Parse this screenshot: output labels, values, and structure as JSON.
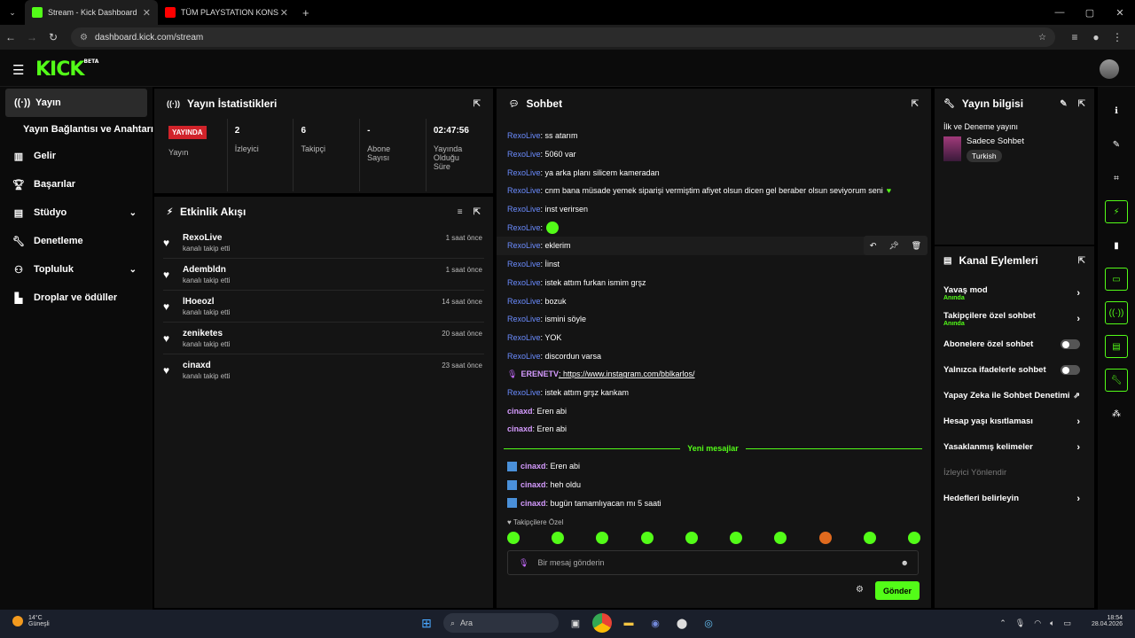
{
  "browser": {
    "tabs": [
      {
        "label": "Stream - Kick Dashboard",
        "active": true
      },
      {
        "label": "TÜM PLAYSTATION KONSOLLAR",
        "active": false
      }
    ],
    "new_tab": "+",
    "url": "dashboard.kick.com/stream"
  },
  "brand": {
    "logo": "KICK",
    "beta": "BETA",
    "accent": "#53fc18"
  },
  "sidebar": {
    "items": [
      {
        "label": "Yayın",
        "icon": "broadcast-icon"
      },
      {
        "label": "Yayın Bağlantısı ve Anahtarı",
        "sub": true
      },
      {
        "label": "Gelir",
        "icon": "revenue-icon"
      },
      {
        "label": "Başarılar",
        "icon": "trophy-icon"
      },
      {
        "label": "Stüdyo",
        "icon": "studio-icon",
        "chevron": true
      },
      {
        "label": "Denetleme",
        "icon": "wrench-icon"
      },
      {
        "label": "Topluluk",
        "icon": "community-icon",
        "chevron": true
      },
      {
        "label": "Droplar ve ödüller",
        "icon": "drops-icon"
      }
    ]
  },
  "stats": {
    "title": "Yayın İstatistikleri",
    "live_badge": "YAYINDA",
    "items": [
      {
        "value": "2",
        "label": "İzleyici"
      },
      {
        "value": "6",
        "label": "Takipçi"
      },
      {
        "value": "-",
        "label": "Abone Sayısı"
      },
      {
        "value": "02:47:56",
        "label": "Yayında Olduğu Süre"
      }
    ],
    "live_label": "Yayın"
  },
  "activity": {
    "title": "Etkinlik Akışı",
    "events": [
      {
        "name": "RexoLive",
        "action": "kanalı takip etti",
        "time": "1 saat önce"
      },
      {
        "name": "Adembldn",
        "action": "kanalı takip etti",
        "time": "1 saat önce"
      },
      {
        "name": "lHoeozl",
        "action": "kanalı takip etti",
        "time": "14 saat önce"
      },
      {
        "name": "zeniketes",
        "action": "kanalı takip etti",
        "time": "20 saat önce"
      },
      {
        "name": "cinaxd",
        "action": "kanalı takip etti",
        "time": "23 saat önce"
      }
    ]
  },
  "chat": {
    "title": "Sohbet",
    "messages": [
      {
        "user": "RexoLive",
        "text": ": ss atarım"
      },
      {
        "user": "RexoLive",
        "text": ": 5060 var"
      },
      {
        "user": "RexoLive",
        "text": ": ya arka planı silicem kameradan"
      },
      {
        "user": "RexoLive",
        "text": ": cnm bana müsade yemek siparişi vermiştim afiyet olsun dicen gel beraber olsun seviyorum seni"
      },
      {
        "user": "RexoLive",
        "text": ": inst verirsen"
      },
      {
        "user": "RexoLive",
        "text": ":"
      },
      {
        "user": "RexoLive",
        "text": ": eklerim"
      },
      {
        "user": "RexoLive",
        "text": ": İinst"
      },
      {
        "user": "RexoLive",
        "text": ": istek attım furkan ismim grşz"
      },
      {
        "user": "RexoLive",
        "text": ": bozuk"
      },
      {
        "user": "RexoLive",
        "text": ": ismini söyle"
      },
      {
        "user": "RexoLive",
        "text": ": YOK"
      },
      {
        "user": "RexoLive",
        "text": ": discordun varsa"
      },
      {
        "user": "ERENETV",
        "text": ": https://www.instagram.com/bblkarlos/",
        "owner": true
      },
      {
        "user": "RexoLive",
        "text": ": istek attım grşz kankam"
      },
      {
        "user": "cinaxd",
        "text": ": Eren abi"
      },
      {
        "user": "cinaxd",
        "text": ": Eren abi"
      }
    ],
    "new_messages_label": "Yeni mesajlar",
    "new_messages": [
      {
        "user": "cinaxd",
        "text": ": Eren abi"
      },
      {
        "user": "cinaxd",
        "text": ": heh oldu"
      },
      {
        "user": "cinaxd",
        "text": ": bugün tamamlıyacan mı 5 saati"
      }
    ],
    "followers_only": "Takipçilere Özel",
    "input_placeholder": "Bir mesaj gönderin",
    "send_label": "Gönder"
  },
  "stream_info": {
    "title": "Yayın bilgisi",
    "stream_title": "İlk ve Deneme yayını",
    "category": "Sadece Sohbet",
    "language": "Turkish"
  },
  "channel_actions": {
    "title": "Kanal Eylemleri",
    "items": [
      {
        "label": "Yavaş mod",
        "sub": "Anında",
        "control": "arrow"
      },
      {
        "label": "Takipçilere özel sohbet",
        "sub": "Anında",
        "control": "arrow"
      },
      {
        "label": "Abonelere özel sohbet",
        "control": "toggle"
      },
      {
        "label": "Yalnızca ifadelerle sohbet",
        "control": "toggle"
      },
      {
        "label": "Yapay Zeka ile Sohbet Denetimi",
        "control": "external"
      },
      {
        "label": "Hesap yaşı kısıtlaması",
        "control": "arrow"
      },
      {
        "label": "Yasaklanmış kelimeler",
        "control": "arrow"
      },
      {
        "label": "İzleyici Yönlendir",
        "control": "none",
        "disabled": true
      },
      {
        "label": "Hedefleri belirleyin",
        "control": "arrow"
      }
    ]
  },
  "taskbar": {
    "temp": "14°C",
    "weather": "Güneşli",
    "search": "Ara",
    "time": "18:54",
    "date": "28.04.2026"
  }
}
